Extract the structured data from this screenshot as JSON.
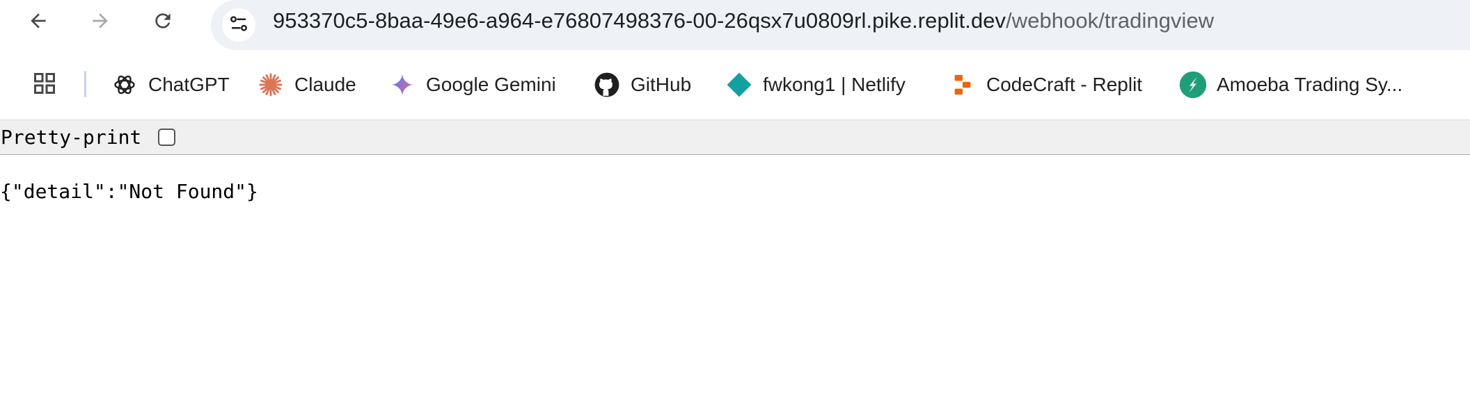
{
  "browser": {
    "url_host": "953370c5-8baa-49e6-a964-e76807498376-00-26qsx7u0809rl.pike.replit.dev",
    "url_path": "/webhook/tradingview",
    "nav_icons": [
      "back-arrow-icon",
      "forward-arrow-icon",
      "reload-icon",
      "site-info-icon"
    ]
  },
  "bookmarks": {
    "apps_icon": "apps-grid-icon",
    "items": [
      {
        "label": "ChatGPT",
        "icon": "chatgpt-icon"
      },
      {
        "label": "Claude",
        "icon": "claude-icon",
        "color": "#d97757"
      },
      {
        "label": "Google Gemini",
        "icon": "gemini-icon"
      },
      {
        "label": "GitHub",
        "icon": "github-icon"
      },
      {
        "label": "fwkong1 | Netlify",
        "icon": "netlify-icon",
        "color": "#14a0a0"
      },
      {
        "label": "CodeCraft - Replit",
        "icon": "replit-icon",
        "color": "#f26207"
      },
      {
        "label": "Amoeba Trading Sy...",
        "icon": "amoeba-icon",
        "color": "#1f9e7a"
      }
    ]
  },
  "viewer": {
    "pretty_print_label": "Pretty-print",
    "pretty_print_checked": false,
    "json_text": "{\"detail\":\"Not Found\"}"
  }
}
